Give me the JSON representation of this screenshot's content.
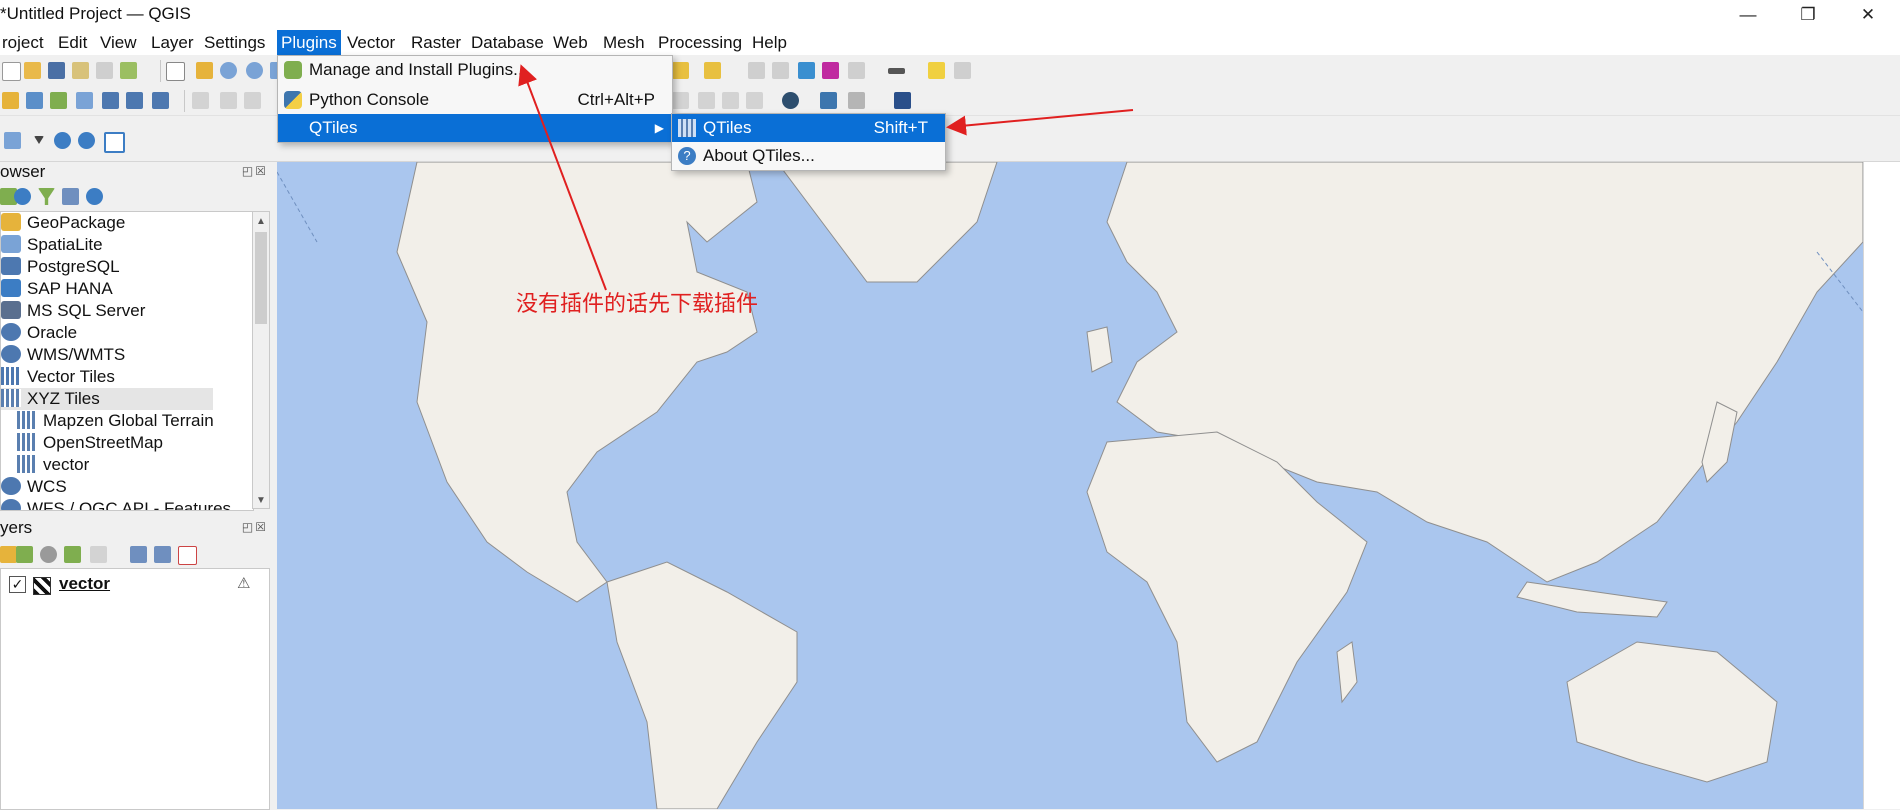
{
  "window": {
    "title": "*Untitled Project — QGIS",
    "minimize": "—",
    "maximize": "❐",
    "close": "✕"
  },
  "menubar": [
    "roject",
    "Edit",
    "View",
    "Layer",
    "Settings",
    "Plugins",
    "Vector",
    "Raster",
    "Database",
    "Web",
    "Mesh",
    "Processing",
    "Help"
  ],
  "plugins_menu": {
    "items": [
      {
        "label": "Manage and Install Plugins...",
        "shortcut": "",
        "icon": "plugin-puzzle-icon"
      },
      {
        "label": "Python Console",
        "shortcut": "Ctrl+Alt+P",
        "icon": "python-icon"
      },
      {
        "label": "QTiles",
        "shortcut": "",
        "icon": "",
        "submenu": true
      }
    ]
  },
  "qtiles_submenu": {
    "items": [
      {
        "label": "QTiles",
        "shortcut": "Shift+T",
        "icon": "qtiles-grid-icon"
      },
      {
        "label": "About QTiles...",
        "shortcut": "",
        "icon": "help-about-icon"
      }
    ]
  },
  "browser_panel": {
    "title": "owser",
    "dock_buttons": "◰☒",
    "items": [
      {
        "label": "GeoPackage",
        "icon": "geopackage-icon",
        "indent": 0
      },
      {
        "label": "SpatiaLite",
        "icon": "spatialite-icon",
        "indent": 0
      },
      {
        "label": "PostgreSQL",
        "icon": "postgresql-icon",
        "indent": 0
      },
      {
        "label": "SAP HANA",
        "icon": "sap-hana-icon",
        "indent": 0
      },
      {
        "label": "MS SQL Server",
        "icon": "mssql-icon",
        "indent": 0
      },
      {
        "label": "Oracle",
        "icon": "oracle-icon",
        "indent": 0
      },
      {
        "label": "WMS/WMTS",
        "icon": "wms-globe-icon",
        "indent": 0
      },
      {
        "label": "Vector Tiles",
        "icon": "vector-tiles-icon",
        "indent": 0
      },
      {
        "label": "XYZ Tiles",
        "icon": "xyz-tiles-icon",
        "indent": 0,
        "selected": true
      },
      {
        "label": "Mapzen Global Terrain",
        "icon": "xyz-tile-layer-icon",
        "indent": 1
      },
      {
        "label": "OpenStreetMap",
        "icon": "xyz-tile-layer-icon",
        "indent": 1
      },
      {
        "label": "vector",
        "icon": "xyz-tile-layer-icon",
        "indent": 1
      },
      {
        "label": "WCS",
        "icon": "wcs-globe-icon",
        "indent": 0
      },
      {
        "label": "WFS / OGC API - Features",
        "icon": "wfs-globe-icon",
        "indent": 0
      }
    ]
  },
  "layers_panel": {
    "title": "yers",
    "dock_buttons": "◰☒",
    "layers": [
      {
        "name": "vector",
        "checked": true,
        "check_mark": "✓",
        "warning": "⚠"
      }
    ]
  },
  "annotation": {
    "text": "没有插件的话先下载插件",
    "color": "#e02020"
  },
  "colors": {
    "accent": "#0a6fd6",
    "ocean": "#aac6ee",
    "land": "#f2efe9"
  }
}
